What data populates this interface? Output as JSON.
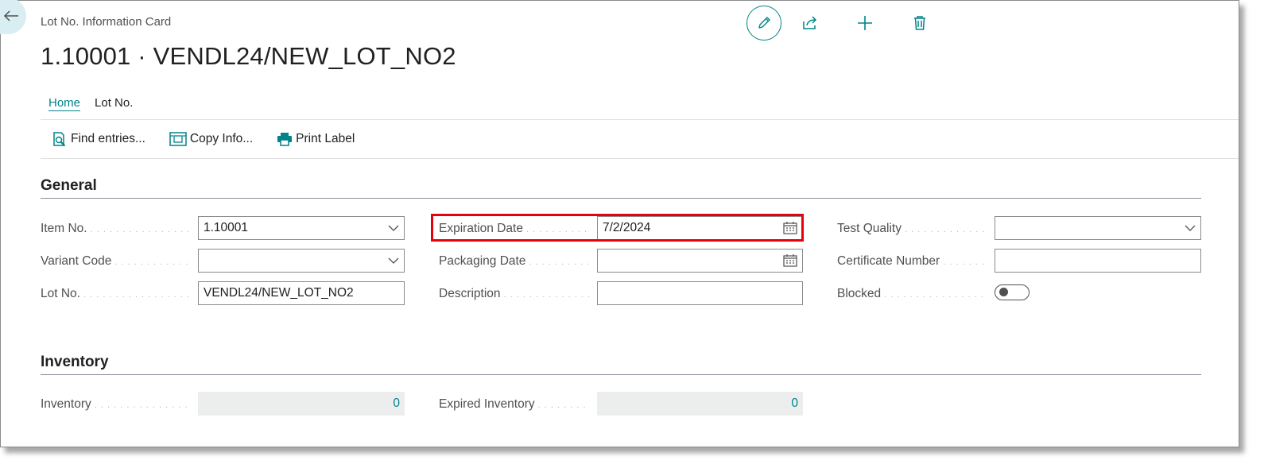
{
  "header": {
    "caption": "Lot No. Information Card",
    "title": "1.10001 · VENDL24/NEW_LOT_NO2"
  },
  "actions": {
    "edit": "edit-icon",
    "share": "share-icon",
    "new": "plus-icon",
    "delete": "trash-icon"
  },
  "tabs": [
    {
      "label": "Home",
      "active": true
    },
    {
      "label": "Lot No.",
      "active": false
    }
  ],
  "toolbar": {
    "find_entries": "Find entries...",
    "copy_info": "Copy Info...",
    "print_label": "Print Label"
  },
  "general": {
    "title": "General",
    "item_no": {
      "label": "Item No.",
      "value": "1.10001"
    },
    "variant_code": {
      "label": "Variant Code",
      "value": ""
    },
    "lot_no": {
      "label": "Lot No.",
      "value": "VENDL24/NEW_LOT_NO2"
    },
    "expiration_date": {
      "label": "Expiration Date",
      "value": "7/2/2024"
    },
    "packaging_date": {
      "label": "Packaging Date",
      "value": ""
    },
    "description": {
      "label": "Description",
      "value": ""
    },
    "test_quality": {
      "label": "Test Quality",
      "value": ""
    },
    "certificate_number": {
      "label": "Certificate Number",
      "value": ""
    },
    "blocked": {
      "label": "Blocked",
      "value": false
    }
  },
  "inventory": {
    "title": "Inventory",
    "inventory": {
      "label": "Inventory",
      "value": "0"
    },
    "expired_inventory": {
      "label": "Expired Inventory",
      "value": "0"
    }
  },
  "colors": {
    "accent": "#00838a",
    "highlight": "#e8000f"
  }
}
